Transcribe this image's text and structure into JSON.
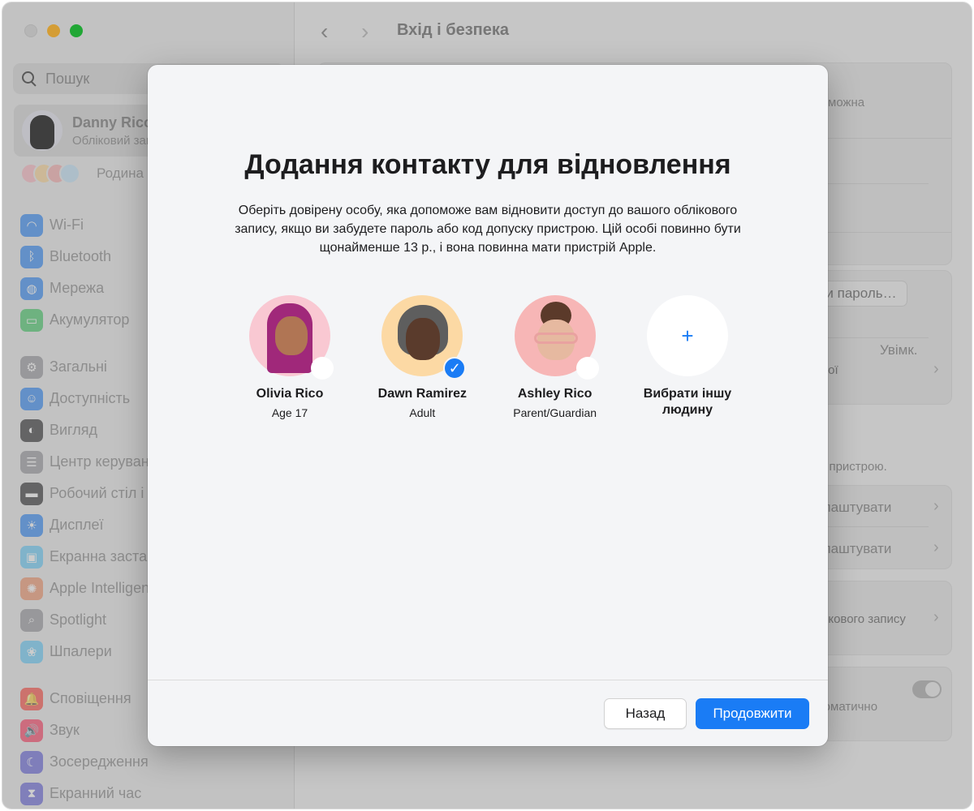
{
  "window": {
    "title": "Вхід і безпека",
    "traffic_lights": [
      "close",
      "minimize",
      "maximize"
    ]
  },
  "sidebar": {
    "search": {
      "placeholder": "Пошук",
      "icon": "magnifier-icon"
    },
    "account": {
      "name": "Danny Rico",
      "subtitle": "Обліковий запис Apple"
    },
    "family": {
      "label": "Родина"
    },
    "groups": [
      [
        {
          "label": "Wi-Fi",
          "icon": "wifi-icon",
          "color": "#1a7cf5",
          "glyph": "◠"
        },
        {
          "label": "Bluetooth",
          "icon": "bluetooth-icon",
          "color": "#1a7cf5",
          "glyph": "ᛒ"
        },
        {
          "label": "Мережа",
          "icon": "globe-icon",
          "color": "#1a7cf5",
          "glyph": "◍"
        },
        {
          "label": "Акумулятор",
          "icon": "battery-icon",
          "color": "#34c759",
          "glyph": "▭"
        }
      ],
      [
        {
          "label": "Загальні",
          "icon": "gear-icon",
          "color": "#8e8e93",
          "glyph": "⚙"
        },
        {
          "label": "Доступність",
          "icon": "accessibility-icon",
          "color": "#1a7cf5",
          "glyph": "☺"
        },
        {
          "label": "Вигляд",
          "icon": "appearance-icon",
          "color": "#1d1d1f",
          "glyph": "◐"
        },
        {
          "label": "Центр керування",
          "icon": "control-center-icon",
          "color": "#8e8e93",
          "glyph": "☰"
        },
        {
          "label": "Робочий стіл і Dock",
          "icon": "desktop-dock-icon",
          "color": "#1d1d1f",
          "glyph": "▬"
        },
        {
          "label": "Дисплеї",
          "icon": "display-brightness-icon",
          "color": "#1a7cf5",
          "glyph": "☀"
        },
        {
          "label": "Екранна заставка",
          "icon": "screensaver-icon",
          "color": "#5ac8fa",
          "glyph": "▣"
        },
        {
          "label": "Apple Intelligence і Siri",
          "icon": "apple-intelligence-icon",
          "color": "#f08a5d",
          "glyph": "✺"
        },
        {
          "label": "Spotlight",
          "icon": "spotlight-icon",
          "color": "#8e8e93",
          "glyph": "⌕"
        },
        {
          "label": "Шпалери",
          "icon": "wallpaper-icon",
          "color": "#5ac8fa",
          "glyph": "❀"
        }
      ],
      [
        {
          "label": "Сповіщення",
          "icon": "notifications-icon",
          "color": "#ff3b30",
          "glyph": "🔔"
        },
        {
          "label": "Звук",
          "icon": "sound-icon",
          "color": "#ff2d55",
          "glyph": "🔊"
        },
        {
          "label": "Зосередження",
          "icon": "focus-moon-icon",
          "color": "#5856d6",
          "glyph": "☾"
        },
        {
          "label": "Екранний час",
          "icon": "hourglass-icon",
          "color": "#5856d6",
          "glyph": "⧗"
        }
      ]
    ]
  },
  "background": {
    "text_1": "можна",
    "change_password": "Змінити пароль…",
    "status_on": "Увімк.",
    "text_2": "вашої",
    "passcode_note": "допуску пристрою.",
    "setup_1": "Налаштувати",
    "setup_2": "Налаштувати",
    "account_text": "облікового запису",
    "auto_text": "автоматично"
  },
  "modal": {
    "title": "Додання контакту для відновлення",
    "description": "Оберіть довірену особу, яка допоможе вам відновити доступ до вашого облікового запису, якщо ви забудете пароль або код допуску пристрою. Цій особі повинно бути щонайменше 13 р., і вона повинна мати пристрій Apple.",
    "contacts": [
      {
        "name": "Olivia Rico",
        "role": "Age 17",
        "selected": false,
        "bg": "#f9c8d2"
      },
      {
        "name": "Dawn Ramirez",
        "role": "Adult",
        "selected": true,
        "bg": "#fcd9a4"
      },
      {
        "name": "Ashley Rico",
        "role": "Parent/Guardian",
        "selected": false,
        "bg": "#f7b6b6"
      }
    ],
    "other_person": {
      "label": "Вибрати іншу людину",
      "icon": "plus-icon"
    },
    "buttons": {
      "back": "Назад",
      "continue": "Продовжити"
    },
    "accent": "#1a7cf5"
  }
}
